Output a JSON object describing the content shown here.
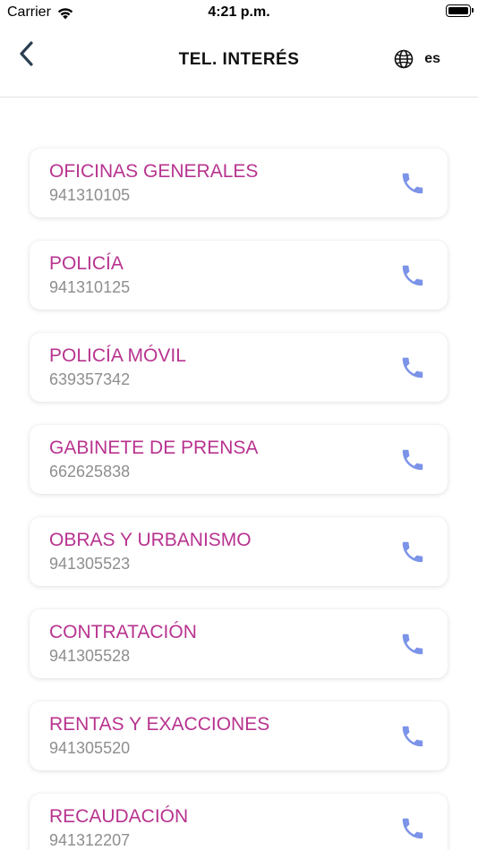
{
  "status_bar": {
    "carrier": "Carrier",
    "time": "4:21 p.m."
  },
  "header": {
    "title": "TEL. INTERÉS",
    "language": "es"
  },
  "icons": {
    "back": "chevron-left-icon",
    "language": "globe-icon",
    "call": "phone-icon",
    "wifi": "wifi-icon",
    "battery": "battery-icon"
  },
  "colors": {
    "name_text": "#b8338f",
    "phone_text": "#8e8e8e",
    "call_icon": "#7b93e8",
    "back_icon": "#2c3e50"
  },
  "contacts": [
    {
      "name": "OFICINAS GENERALES",
      "phone": "941310105"
    },
    {
      "name": "POLICÍA",
      "phone": "941310125"
    },
    {
      "name": "POLICÍA MÓVIL",
      "phone": "639357342"
    },
    {
      "name": "GABINETE DE PRENSA",
      "phone": "662625838"
    },
    {
      "name": "OBRAS Y URBANISMO",
      "phone": "941305523"
    },
    {
      "name": "CONTRATACIÓN",
      "phone": "941305528"
    },
    {
      "name": "RENTAS Y EXACCIONES",
      "phone": "941305520"
    },
    {
      "name": "RECAUDACIÓN",
      "phone": "941312207"
    }
  ]
}
